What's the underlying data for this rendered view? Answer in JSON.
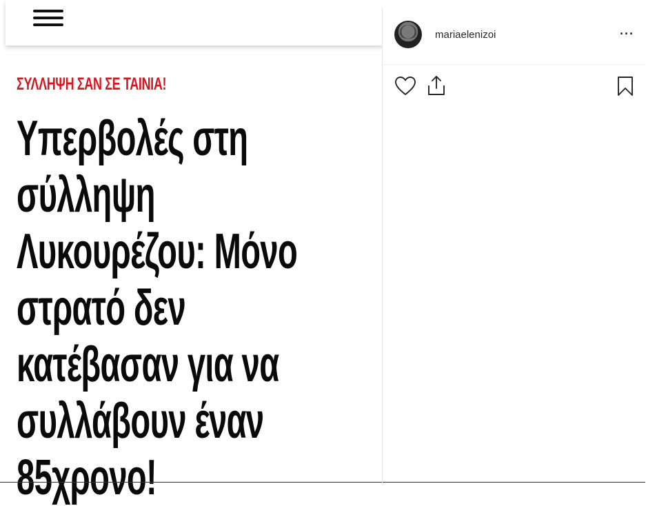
{
  "article": {
    "kicker": "ΣΥΛΛΗΨΗ ΣΑΝ ΣΕ ΤΑΙΝΙΑ!",
    "headline_lines": [
      "Υπερβολές στη",
      "σύλληψη",
      "Λυκουρέζου: Μόνο",
      "στρατό δεν",
      "κατέβασαν για να",
      "συλλάβουν έναν",
      "85χρονο!"
    ]
  },
  "instagram": {
    "username": "mariaelenizoi",
    "more_label": "···"
  },
  "colors": {
    "kicker": "#d8141f",
    "headline": "#0a0a0a",
    "icon_stroke": "#262626"
  }
}
